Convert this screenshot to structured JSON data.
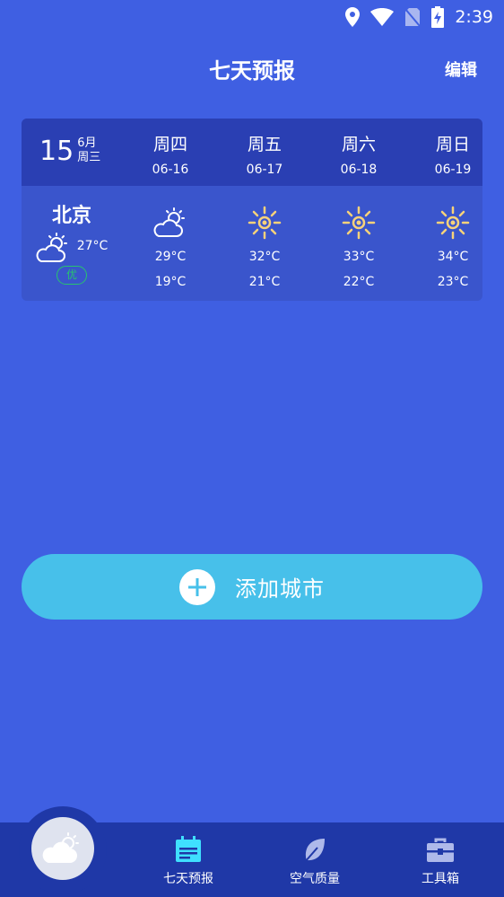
{
  "status_bar": {
    "time": "2:39"
  },
  "header": {
    "title": "七天预报",
    "edit_label": "编辑"
  },
  "today": {
    "day": "15",
    "month": "6月",
    "weekday": "周三",
    "city": "北京",
    "temp": "27°C",
    "aqi": "优",
    "icon": "partly-cloudy-icon"
  },
  "days": [
    {
      "name": "周四",
      "date": "06-16",
      "high": "29°C",
      "low": "19°C",
      "icon": "partly-cloudy-icon"
    },
    {
      "name": "周五",
      "date": "06-17",
      "high": "32°C",
      "low": "21°C",
      "icon": "sunny-icon"
    },
    {
      "name": "周六",
      "date": "06-18",
      "high": "33°C",
      "low": "22°C",
      "icon": "sunny-icon"
    },
    {
      "name": "周日",
      "date": "06-19",
      "high": "34°C",
      "low": "23°C",
      "icon": "sunny-icon"
    }
  ],
  "add_city": {
    "label": "添加城市"
  },
  "tabbar": {
    "tabs": [
      {
        "label": "七天预报",
        "icon": "calendar-icon",
        "active": true
      },
      {
        "label": "空气质量",
        "icon": "leaf-icon",
        "active": false
      },
      {
        "label": "工具箱",
        "icon": "toolbox-icon",
        "active": false
      }
    ]
  },
  "colors": {
    "background": "#3f5fe2",
    "card_header": "#2a3fb3",
    "add_button": "#47c0ea",
    "tabbar": "#1f38a7",
    "aqi_good": "#28c36f",
    "active_tab_icon": "#3fe0ff",
    "sun": "#f7d27a"
  }
}
